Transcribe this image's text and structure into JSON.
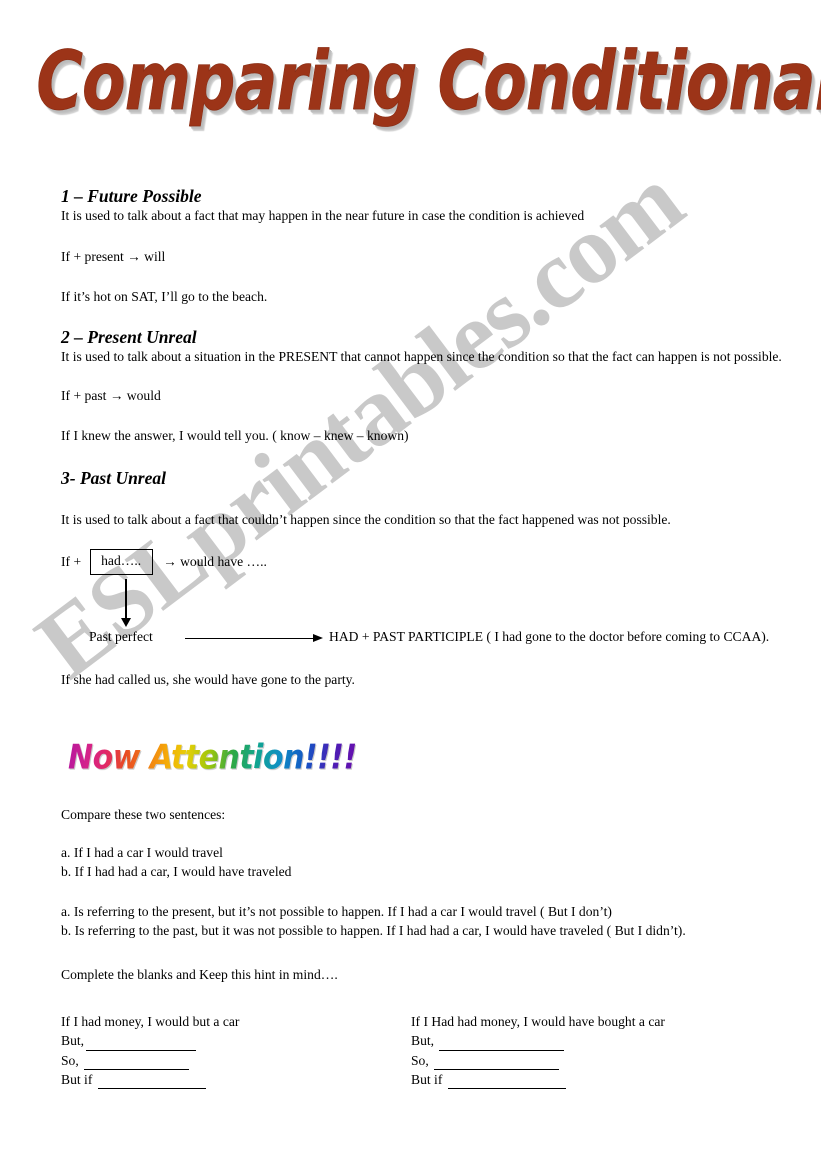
{
  "title": "Comparing Conditionals",
  "watermark": "ESLprintables.com",
  "sections": [
    {
      "heading": "1 – Future Possible",
      "description": "It is used to talk about a fact that may happen in the near future in case the condition is achieved",
      "formula": "If + present →  will",
      "example": "If it’s hot on SAT, I’ll go to the beach."
    },
    {
      "heading": "2 – Present Unreal",
      "description": "It is used to talk about a situation in the PRESENT that cannot happen since the condition so that the fact can happen is not possible.",
      "formula": "If + past → would",
      "example": "If I knew the answer, I would tell you.  ( know – knew – known)"
    },
    {
      "heading": "3- Past Unreal",
      "description": "It is used to talk about a fact that couldn’t happen since the condition so that the fact happened was not possible.",
      "example": "If she had called us, she would have gone to the party."
    }
  ],
  "diagram": {
    "if_label": "If +",
    "box_text": "had…..",
    "tail_text": "→ would have …..",
    "past_perfect_label": "Past perfect",
    "participle_text": "HAD + PAST PARTICIPLE ( I had gone to the doctor before coming to CCAA)."
  },
  "attention": "Now Attention!!!!",
  "compare": {
    "prompt": "Compare these two sentences:",
    "sentence_a": "a. If I had a car I would travel",
    "sentence_b": "b. If I had had a car, I would have traveled",
    "explain_a": "a. Is referring to the present, but it’s not possible to happen. If I had a car I would travel ( But I don’t)",
    "explain_b": "b. Is referring to the past, but it was not possible to happen. If I had had a car, I would have traveled ( But I didn’t).",
    "instruction": "Complete the blanks and Keep this hint in mind…."
  },
  "exercise": {
    "left": {
      "prompt": "If I had money, I would but a car",
      "but_label": "But,",
      "so_label": "So, ",
      "but_if_label": "But if "
    },
    "right": {
      "prompt": "If I Had had money, I would have bought a car",
      "but_label": "But, ",
      "so_label": "So, ",
      "but_if_label": "But if "
    }
  },
  "colors": {
    "title_red": "#9c3418",
    "watermark_gray": "#c9c9c9",
    "text_black": "#000000"
  }
}
